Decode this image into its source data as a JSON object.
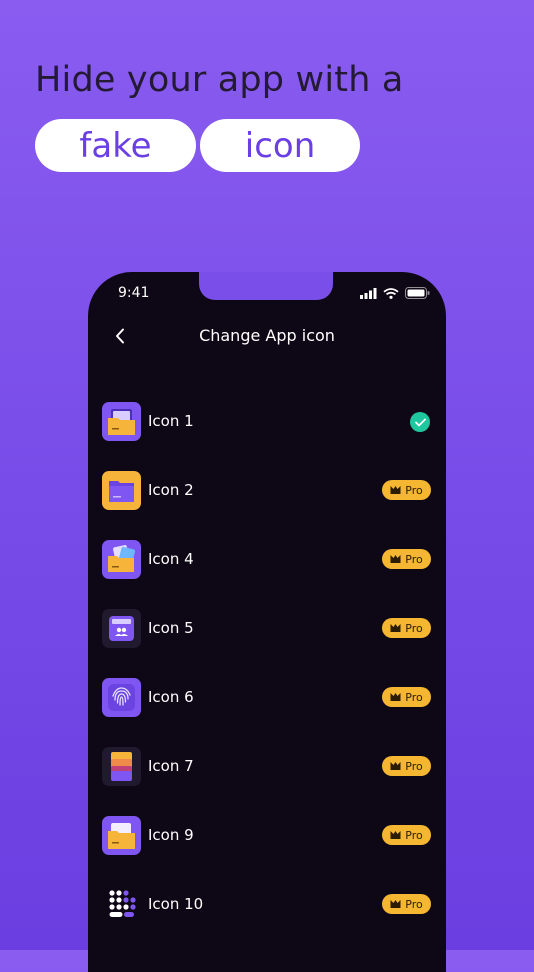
{
  "promo": {
    "headline": "Hide your app with a",
    "pill_fake": "fake",
    "pill_icon": "icon"
  },
  "status_bar": {
    "time": "9:41"
  },
  "nav": {
    "title": "Change App icon"
  },
  "pro_badge_label": "Pro",
  "colors": {
    "accent": "#7a4ee9",
    "check": "#1fc79e",
    "pro_badge": "#f5b731"
  },
  "icons": [
    {
      "label": "Icon 1",
      "selected": true,
      "pro": false,
      "icon": "folder-open-icon"
    },
    {
      "label": "Icon 2",
      "selected": false,
      "pro": true,
      "icon": "folder-icon"
    },
    {
      "label": "Icon 4",
      "selected": false,
      "pro": true,
      "icon": "folder-images-icon"
    },
    {
      "label": "Icon 5",
      "selected": false,
      "pro": true,
      "icon": "contacts-app-icon"
    },
    {
      "label": "Icon 6",
      "selected": false,
      "pro": true,
      "icon": "fingerprint-icon"
    },
    {
      "label": "Icon 7",
      "selected": false,
      "pro": true,
      "icon": "cards-wallet-icon"
    },
    {
      "label": "Icon 9",
      "selected": false,
      "pro": true,
      "icon": "folder-open-icon"
    },
    {
      "label": "Icon 10",
      "selected": false,
      "pro": true,
      "icon": "dots-grid-icon"
    }
  ]
}
